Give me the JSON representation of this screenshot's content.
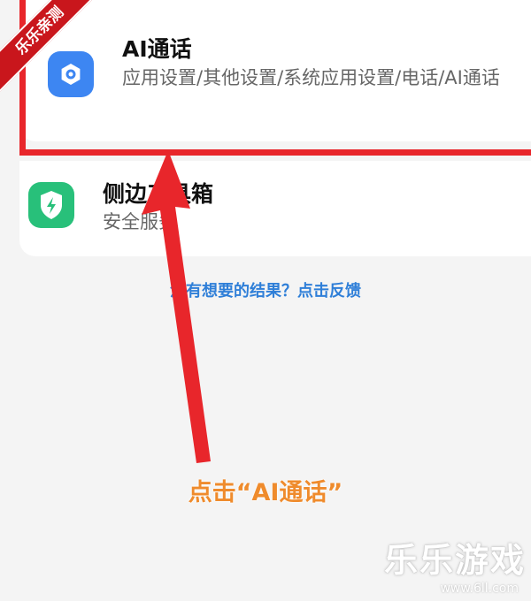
{
  "results": [
    {
      "title": "AI通话",
      "path": "应用设置/其他设置/系统应用设置/电话/AI通话",
      "icon": "settings-gear-icon",
      "icon_color": "#3d86f2"
    },
    {
      "title": "侧边工具箱",
      "path": "安全服务",
      "icon": "shield-bolt-icon",
      "icon_color": "#28c07a"
    }
  ],
  "feedback_link": "没有想要的结果？点击反馈",
  "annotation": {
    "caption": "点击“AI通话”",
    "highlight_color": "#e8262b",
    "caption_color": "#ef8b2c"
  },
  "badge": "乐乐亲测",
  "watermark": {
    "brand": "乐乐游戏",
    "url": "www.6ll.com"
  }
}
